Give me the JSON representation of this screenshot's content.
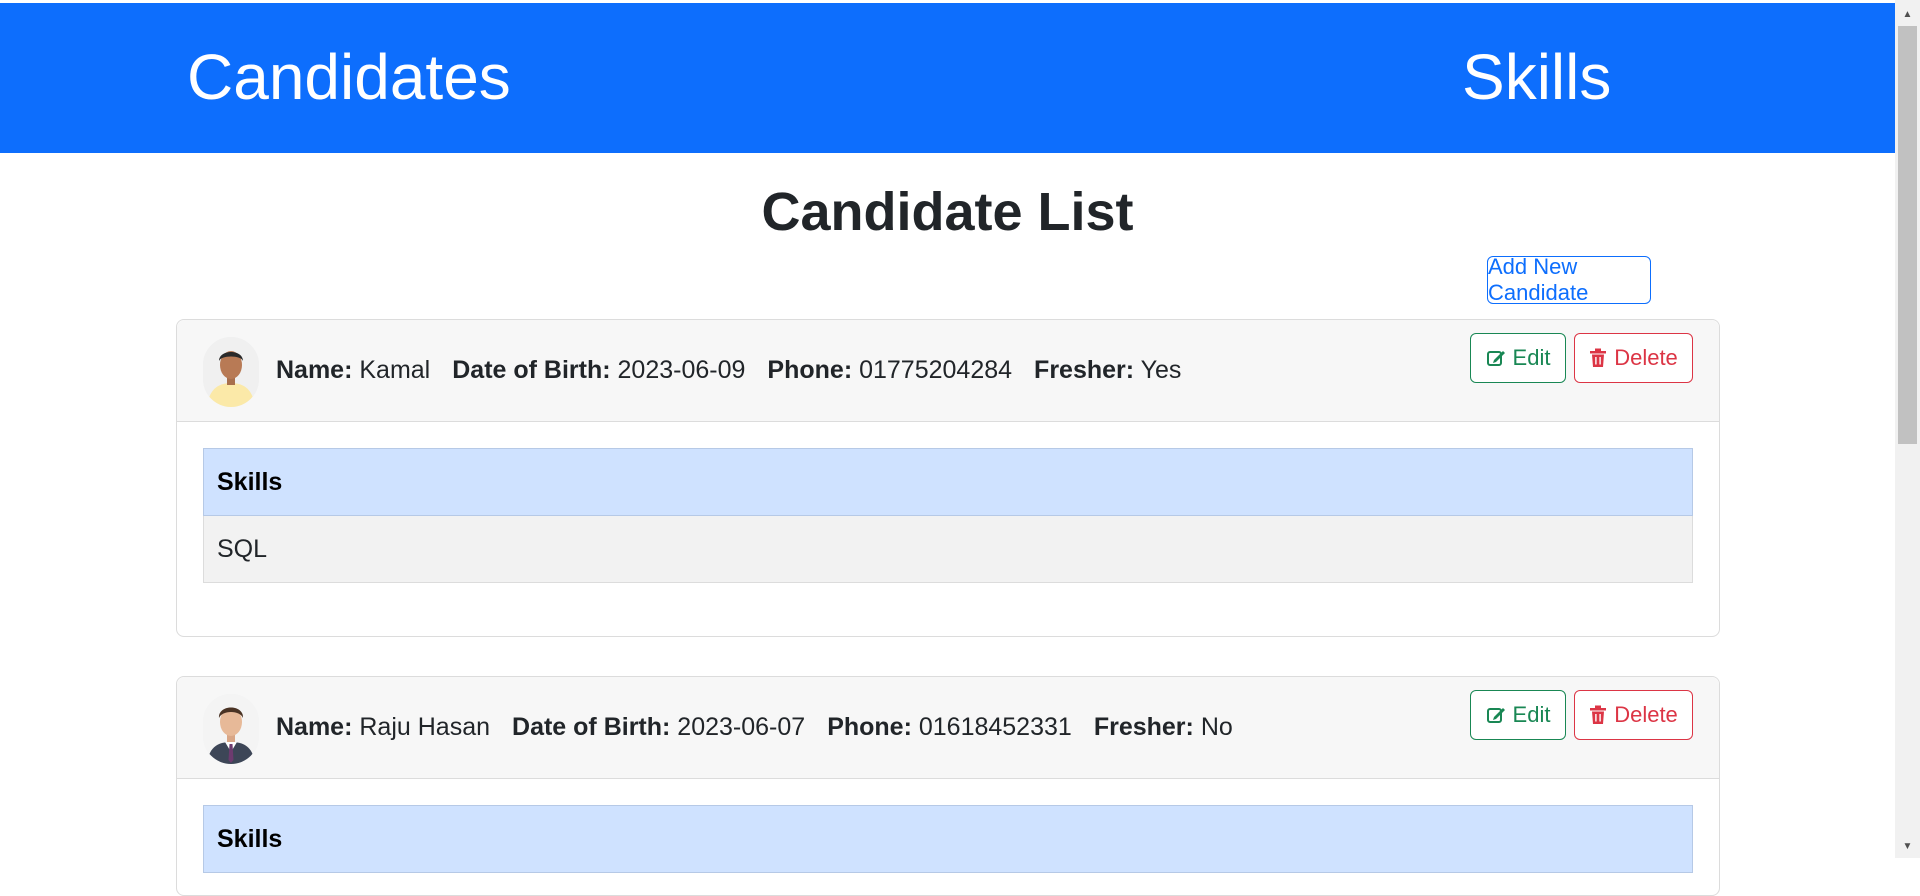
{
  "nav": {
    "candidates": "Candidates",
    "skills": "Skills"
  },
  "page": {
    "title": "Candidate List",
    "add_button": "Add New Candidate"
  },
  "labels": {
    "name": "Name:",
    "dob": "Date of Birth:",
    "phone": "Phone:",
    "fresher": "Fresher:",
    "skills_header": "Skills",
    "edit": "Edit",
    "delete": "Delete"
  },
  "candidates": [
    {
      "name": "Kamal",
      "dob": "2023-06-09",
      "phone": "01775204284",
      "fresher": "Yes",
      "skills": [
        "SQL"
      ]
    },
    {
      "name": "Raju Hasan",
      "dob": "2023-06-07",
      "phone": "01618452331",
      "fresher": "No",
      "skills": []
    }
  ],
  "colors": {
    "primary": "#0d6efd",
    "success": "#198754",
    "danger": "#dc3545",
    "table_header": "#cfe2ff"
  },
  "icons": {
    "edit": "edit-icon",
    "delete": "trash-icon"
  }
}
